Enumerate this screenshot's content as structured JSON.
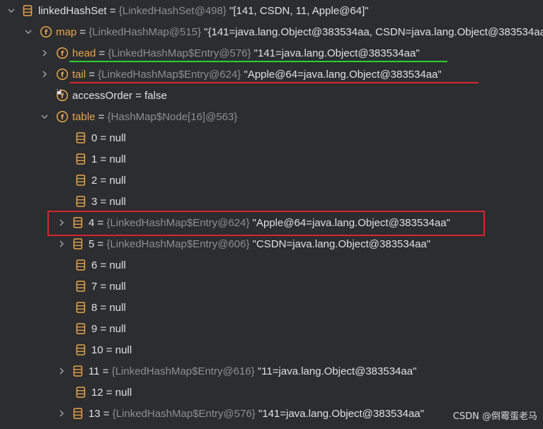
{
  "colors": {
    "background": "#2b2d30",
    "field_name": "#e8a54b",
    "reference": "#8c8f94",
    "value": "#dfe1e5",
    "green_underline": "#2fcf2f",
    "red_marker": "#d6252c"
  },
  "rows": [
    {
      "name": "linkedHashSet",
      "eq": " = ",
      "ref": "{LinkedHashSet@498}",
      "val": " \"[141, CSDN, 11, Apple@64]\""
    },
    {
      "name": "map",
      "eq": " = ",
      "ref": "{LinkedHashMap@515}",
      "val": " \"{141=java.lang.Object@383534aa, CSDN=java.lang.Object@383534aa"
    },
    {
      "name": "head",
      "eq": " = ",
      "ref": "{LinkedHashMap$Entry@576}",
      "val": " \"141=java.lang.Object@383534aa\""
    },
    {
      "name": "tail",
      "eq": " = ",
      "ref": "{LinkedHashMap$Entry@624}",
      "val": " \"Apple@64=java.lang.Object@383534aa\""
    },
    {
      "name": "accessOrder",
      "eq": " = ",
      "ref": "",
      "val": "false"
    },
    {
      "name": "table",
      "eq": " = ",
      "ref": "{HashMap$Node[16]@563}",
      "val": ""
    },
    {
      "name": "0",
      "eq": " = ",
      "ref": "",
      "val": "null"
    },
    {
      "name": "1",
      "eq": " = ",
      "ref": "",
      "val": "null"
    },
    {
      "name": "2",
      "eq": " = ",
      "ref": "",
      "val": "null"
    },
    {
      "name": "3",
      "eq": " = ",
      "ref": "",
      "val": "null"
    },
    {
      "name": "4",
      "eq": " = ",
      "ref": "{LinkedHashMap$Entry@624}",
      "val": " \"Apple@64=java.lang.Object@383534aa\""
    },
    {
      "name": "5",
      "eq": " = ",
      "ref": "{LinkedHashMap$Entry@606}",
      "val": " \"CSDN=java.lang.Object@383534aa\""
    },
    {
      "name": "6",
      "eq": " = ",
      "ref": "",
      "val": "null"
    },
    {
      "name": "7",
      "eq": " = ",
      "ref": "",
      "val": "null"
    },
    {
      "name": "8",
      "eq": " = ",
      "ref": "",
      "val": "null"
    },
    {
      "name": "9",
      "eq": " = ",
      "ref": "",
      "val": "null"
    },
    {
      "name": "10",
      "eq": " = ",
      "ref": "",
      "val": "null"
    },
    {
      "name": "11",
      "eq": " = ",
      "ref": "{LinkedHashMap$Entry@616}",
      "val": " \"11=java.lang.Object@383534aa\""
    },
    {
      "name": "12",
      "eq": " = ",
      "ref": "",
      "val": "null"
    },
    {
      "name": "13",
      "eq": " = ",
      "ref": "{LinkedHashMap$Entry@576}",
      "val": " \"141=java.lang.Object@383534aa\""
    }
  ],
  "icons": {
    "expand": "chevron-right-icon",
    "collapse": "chevron-down-icon",
    "object": "stack-icon",
    "field": "field-f-icon",
    "field_lock": "field-lock-icon"
  },
  "watermark": "CSDN @倒霉蛋老马"
}
